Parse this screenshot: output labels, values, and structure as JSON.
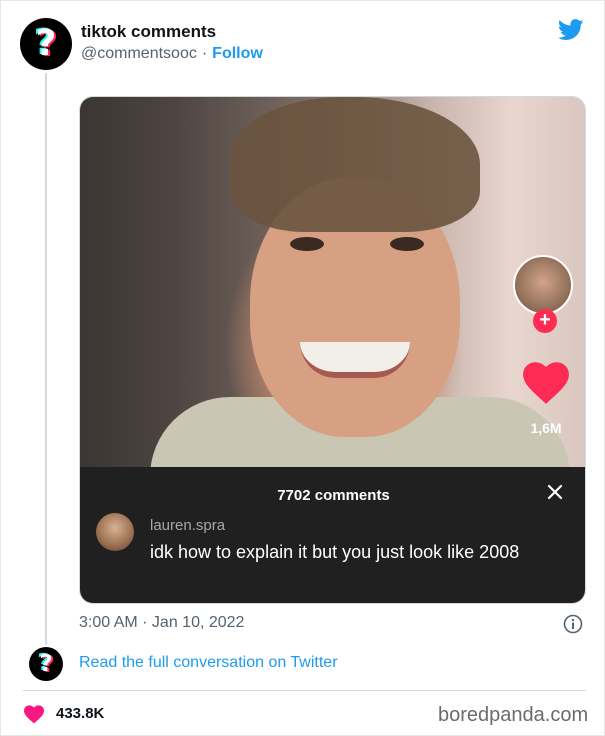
{
  "tweet": {
    "display_name": "tiktok comments",
    "handle": "@commentsooc",
    "separator": "·",
    "follow_label": "Follow",
    "timestamp": "3:00 AM · Jan 10, 2022",
    "read_link": "Read the full conversation on Twitter",
    "like_count": "433.8K",
    "colors": {
      "link": "#1d9bf0",
      "like": "#f91880",
      "tiktok_red": "#fe2c55",
      "tiktok_cyan": "#25f4ee"
    }
  },
  "video": {
    "side_likes": "1,6M",
    "comments_count_label": "7702 comments",
    "comment": {
      "username": "lauren.spra",
      "text": "idk how to explain it but you just look like 2008"
    }
  },
  "watermark": "boredpanda.com",
  "icons": {
    "twitter": "bird-icon",
    "heart": "heart-icon",
    "close": "close-icon",
    "info": "info-icon",
    "plus": "plus-icon"
  }
}
